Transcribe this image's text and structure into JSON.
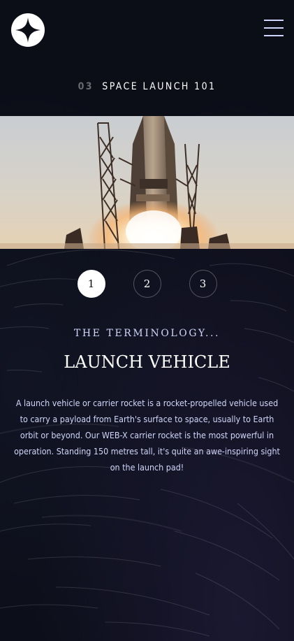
{
  "header": {
    "logo_icon": "star-logo-icon",
    "menu_icon": "hamburger-menu-icon"
  },
  "page": {
    "number": "03",
    "title": "SPACE LAUNCH 101"
  },
  "hero": {
    "image_icon": "rocket-launch-image"
  },
  "steps": [
    {
      "label": "1",
      "active": true
    },
    {
      "label": "2",
      "active": false
    },
    {
      "label": "3",
      "active": false
    }
  ],
  "content": {
    "eyebrow": "THE TERMINOLOGY...",
    "title": "LAUNCH VEHICLE",
    "description": "A launch vehicle or carrier rocket is a rocket-propelled vehicle used to carry a payload from Earth's surface to space, usually to Earth orbit or beyond. Our WEB-X carrier rocket is the most powerful in operation. Standing 150 metres tall, it's quite an awe-inspiring sight on the launch pad!"
  },
  "colors": {
    "background": "#0b0d17",
    "accent_text": "#d0d6f9",
    "white": "#ffffff"
  }
}
